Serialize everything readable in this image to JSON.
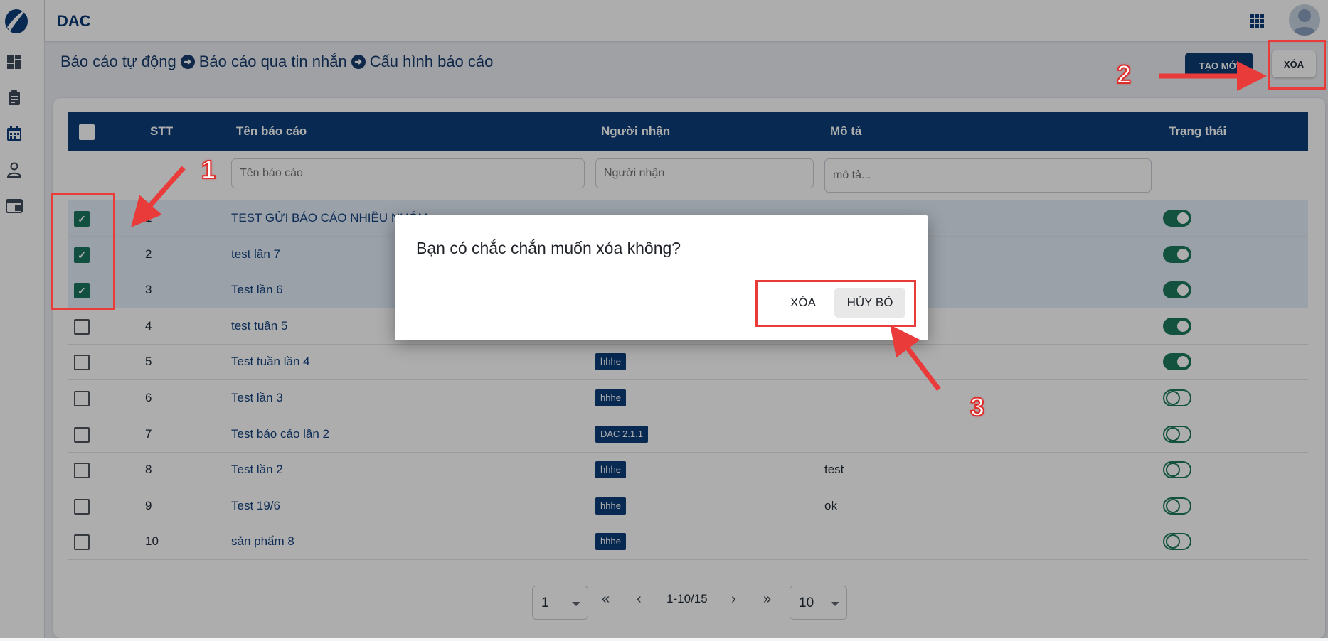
{
  "app": {
    "title": "DAC"
  },
  "breadcrumb": [
    "Báo cáo tự động",
    "Báo cáo qua tin nhắn",
    "Cấu hình báo cáo"
  ],
  "toolbar": {
    "create_label": "TẠO MỚI",
    "delete_label": "XÓA"
  },
  "table": {
    "headers": {
      "stt": "STT",
      "name": "Tên báo cáo",
      "recipient": "Người nhận",
      "description": "Mô tả",
      "status": "Trạng thái"
    },
    "filters": {
      "name_placeholder": "Tên báo cáo",
      "recipient_placeholder": "Người nhận",
      "description_placeholder": "mô tả..."
    },
    "rows": [
      {
        "stt": "1",
        "name": "TEST GỬI BÁO CÁO NHIỀU NHÓM",
        "tags": [],
        "description": "",
        "checked": true,
        "status_on": true
      },
      {
        "stt": "2",
        "name": "test lần 7",
        "tags": [],
        "description": "",
        "checked": true,
        "status_on": true
      },
      {
        "stt": "3",
        "name": "Test lần 6",
        "tags": [],
        "description": "",
        "checked": true,
        "status_on": true
      },
      {
        "stt": "4",
        "name": "test tuần 5",
        "tags": [],
        "description": "",
        "checked": false,
        "status_on": true
      },
      {
        "stt": "5",
        "name": "Test tuần lần 4",
        "tags": [
          "hhhe"
        ],
        "description": "",
        "checked": false,
        "status_on": true
      },
      {
        "stt": "6",
        "name": "Test lần 3",
        "tags": [
          "hhhe"
        ],
        "description": "",
        "checked": false,
        "status_on": false
      },
      {
        "stt": "7",
        "name": "Test báo cáo lần 2",
        "tags": [
          "DAC 2.1.1"
        ],
        "description": "",
        "checked": false,
        "status_on": false
      },
      {
        "stt": "8",
        "name": "Test lần 2",
        "tags": [
          "hhhe"
        ],
        "description": "test",
        "checked": false,
        "status_on": false
      },
      {
        "stt": "9",
        "name": "Test 19/6",
        "tags": [
          "hhhe"
        ],
        "description": "ok",
        "checked": false,
        "status_on": false
      },
      {
        "stt": "10",
        "name": "sản phẩm 8",
        "tags": [
          "hhhe"
        ],
        "description": "",
        "checked": false,
        "status_on": false
      }
    ]
  },
  "pagination": {
    "page": "1",
    "info": "1-10/15",
    "page_size": "10"
  },
  "dialog": {
    "message": "Bạn có chắc chắn muốn xóa không?",
    "confirm_label": "XÓA",
    "cancel_label": "HỦY BỎ"
  },
  "annotations": [
    "1",
    "2",
    "3"
  ],
  "colors": {
    "primary": "#0b3d79",
    "toggle_green": "#1b7a5c",
    "annotation_red": "#ea3b3b"
  }
}
